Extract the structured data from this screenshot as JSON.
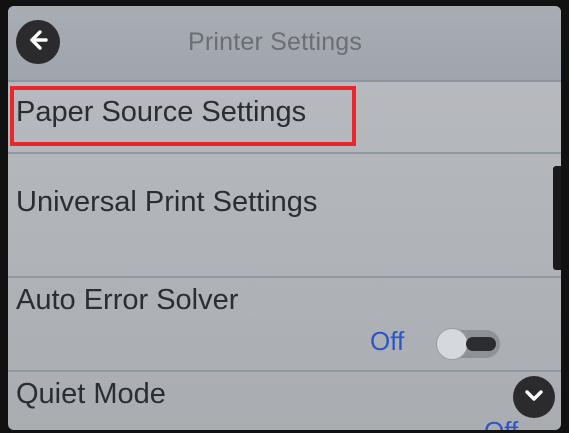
{
  "header": {
    "title": "Printer Settings",
    "back_icon": "arrow-left-icon"
  },
  "menu": {
    "items": [
      {
        "label": "Paper Source Settings",
        "highlighted": true
      },
      {
        "label": "Universal Print Settings"
      },
      {
        "label": "Auto Error Solver",
        "value": "Off",
        "toggle": "off"
      },
      {
        "label": "Quiet Mode",
        "value": "Off",
        "toggle": "off"
      }
    ]
  },
  "footer": {
    "scroll_down_icon": "chevron-down-icon"
  },
  "colors": {
    "highlight_border": "#e8262b",
    "value_text": "#2d55c8",
    "button_bg": "#2b2b2e"
  }
}
